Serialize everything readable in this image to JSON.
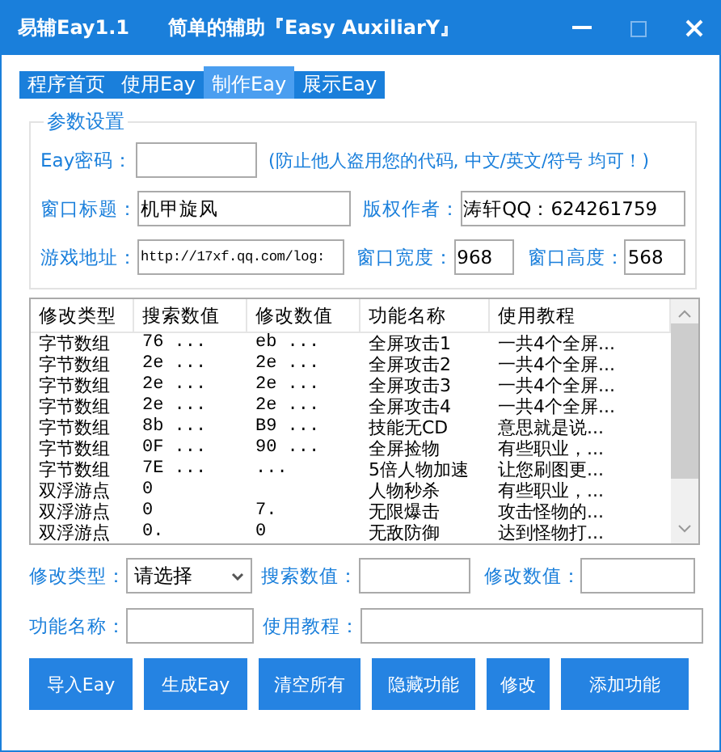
{
  "window": {
    "app_name": "易辅Eay1.1",
    "title": "简单的辅助『Easy AuxiliarY』"
  },
  "tabs": [
    {
      "label": "程序首页",
      "selected": false
    },
    {
      "label": "使用Eay",
      "selected": false
    },
    {
      "label": "制作Eay",
      "selected": true
    },
    {
      "label": "展示Eay",
      "selected": false
    }
  ],
  "settings": {
    "legend": "参数设置",
    "password_label": "Eay密码：",
    "password_hint": "(防止他人盗用您的代码, 中文/英文/符号  均可！)",
    "title_label": "窗口标题：",
    "title_value": "机甲旋风",
    "author_label": "版权作者：",
    "author_value": "涛轩QQ：624261759",
    "url_label": "游戏地址：",
    "url_value": "http://17xf.qq.com/log:",
    "width_label": "窗口宽度：",
    "width_value": "968",
    "height_label": "窗口高度：",
    "height_value": "568"
  },
  "table": {
    "columns": [
      "修改类型",
      "搜索数值",
      "修改数值",
      "功能名称",
      "使用教程"
    ],
    "rows": [
      [
        "字节数组",
        "76  ...",
        "eb  ...",
        "全屏攻击1",
        "一共4个全屏..."
      ],
      [
        "字节数组",
        "2e  ...",
        "2e  ...",
        "全屏攻击2",
        "一共4个全屏..."
      ],
      [
        "字节数组",
        "2e  ...",
        "2e  ...",
        "全屏攻击3",
        "一共4个全屏..."
      ],
      [
        "字节数组",
        "2e  ...",
        "2e  ...",
        "全屏攻击4",
        "一共4个全屏..."
      ],
      [
        "字节数组",
        "8b  ...",
        "B9  ...",
        "技能无CD",
        "意思就是说..."
      ],
      [
        "字节数组",
        "0F  ...",
        "90  ...",
        "全屏捡物",
        "有些职业，..."
      ],
      [
        "字节数组",
        "7E  ...",
        "   ...",
        "5倍人物加速",
        "让您刷图更..."
      ],
      [
        "双浮游点",
        "0",
        "",
        "人物秒杀",
        "有些职业，..."
      ],
      [
        "双浮游点",
        "0",
        "7.",
        "无限爆击",
        "攻击怪物的..."
      ],
      [
        "双浮游点",
        "0.",
        "0",
        "无敌防御",
        "达到怪物打..."
      ]
    ]
  },
  "form": {
    "type_label": "修改类型：",
    "type_value": "请选择",
    "search_label": "搜索数值：",
    "modify_label": "修改数值：",
    "name_label": "功能名称：",
    "tutorial_label": "使用教程："
  },
  "buttons": [
    "导入Eay",
    "生成Eay",
    "清空所有",
    "隐藏功能",
    "修改",
    "添加功能"
  ]
}
